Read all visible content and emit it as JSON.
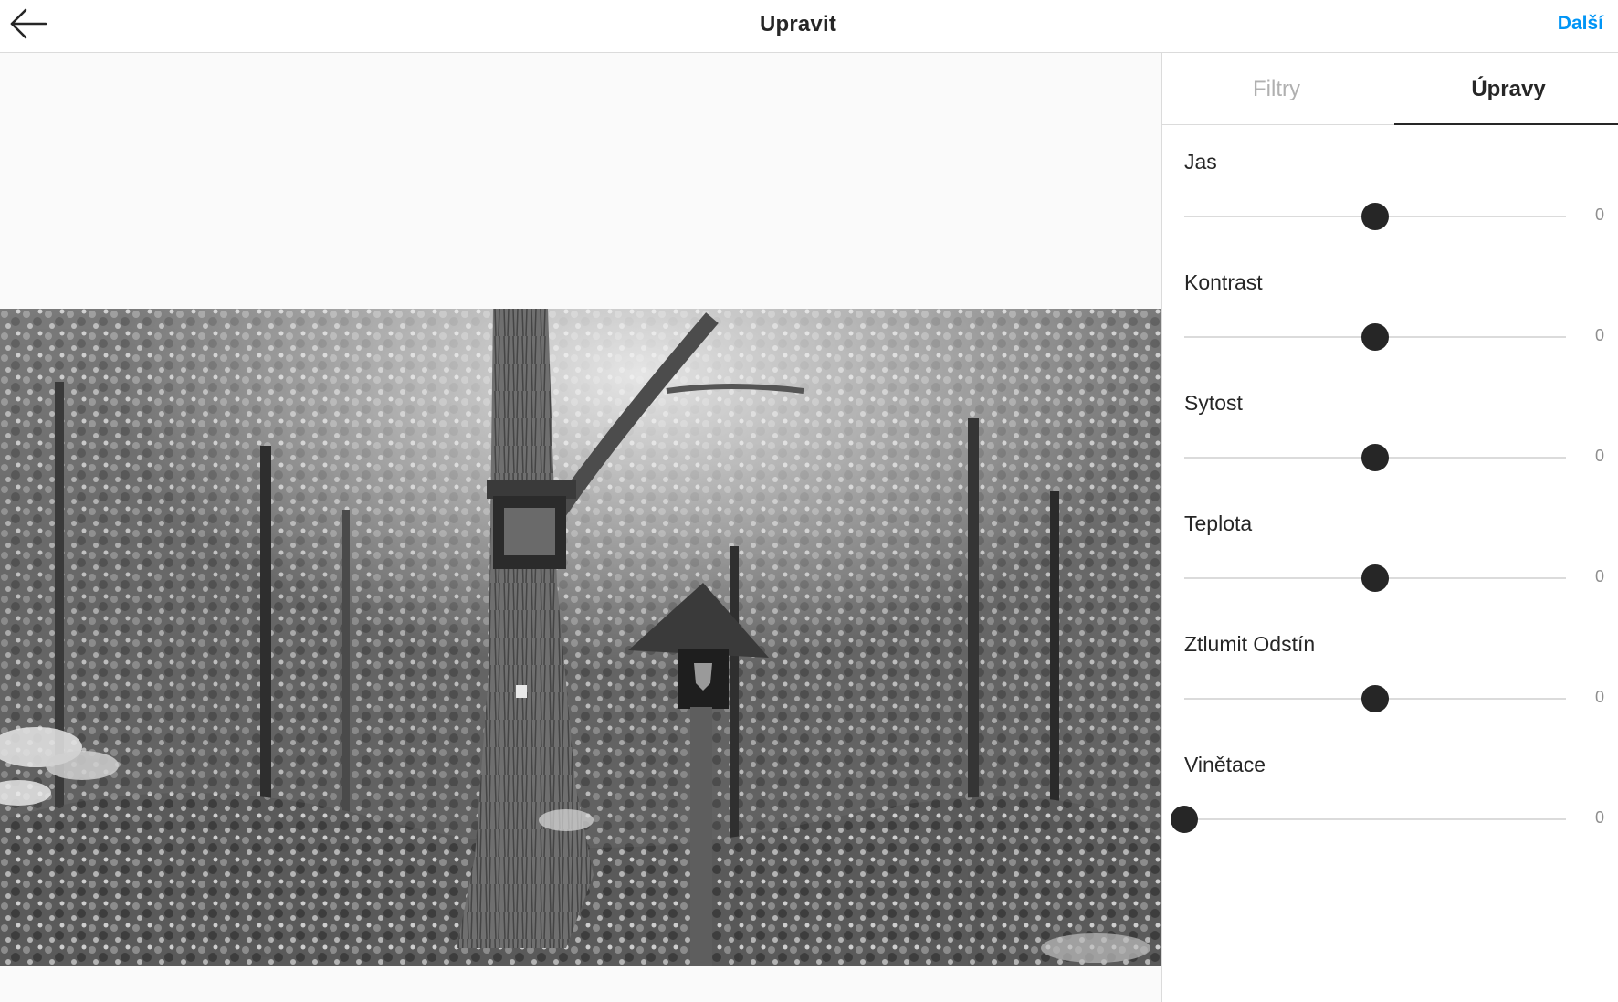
{
  "header": {
    "title": "Upravit",
    "next_label": "Další"
  },
  "tabs": [
    {
      "label": "Filtry",
      "active": false
    },
    {
      "label": "Úpravy",
      "active": true
    }
  ],
  "adjustments": [
    {
      "label": "Jas",
      "value": "0",
      "position": 0.5
    },
    {
      "label": "Kontrast",
      "value": "0",
      "position": 0.5
    },
    {
      "label": "Sytost",
      "value": "0",
      "position": 0.5
    },
    {
      "label": "Teplota",
      "value": "0",
      "position": 0.5
    },
    {
      "label": "Ztlumit Odstín",
      "value": "0",
      "position": 0.5
    },
    {
      "label": "Vinětace",
      "value": "0",
      "position": 0.0
    }
  ],
  "icons": {
    "back": "arrow-left-icon"
  },
  "colors": {
    "accent": "#0095f6",
    "thumb": "#262626"
  }
}
